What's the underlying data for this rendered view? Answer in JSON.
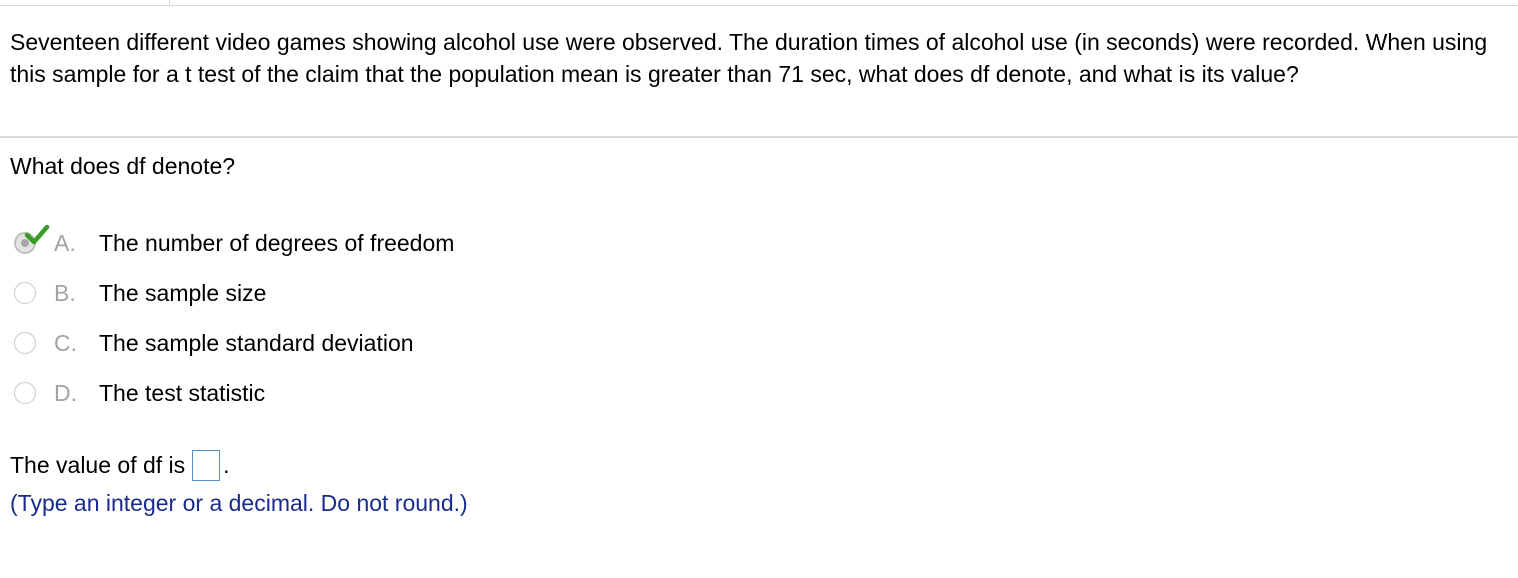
{
  "question": {
    "text": "Seventeen different video games showing alcohol use were observed. The duration times of alcohol use (in seconds) were recorded. When using this sample for a t test of the claim that the population mean is greater than 71 sec, what does df denote, and what is its value?"
  },
  "part1": {
    "prompt": "What does df denote?",
    "selected": "A",
    "choices": [
      {
        "letter": "A.",
        "text": "The number of degrees of freedom",
        "selected": true,
        "correct": true
      },
      {
        "letter": "B.",
        "text": "The sample size",
        "selected": false
      },
      {
        "letter": "C.",
        "text": "The sample standard deviation",
        "selected": false
      },
      {
        "letter": "D.",
        "text": "The test statistic",
        "selected": false
      }
    ]
  },
  "part2": {
    "label": "The value of df is",
    "value": "",
    "suffix": ".",
    "hint": "(Type an integer or a decimal. Do not round.)"
  },
  "icons": {
    "selected_radio": "radio-selected-icon",
    "unselected_radio": "radio-unselected-icon",
    "correct_check": "checkmark-icon"
  },
  "colors": {
    "check_green": "#3a9d23",
    "hint_blue": "#1a2b8c",
    "letter_gray": "#a3a3a3",
    "input_border": "#5b8fc7",
    "divider": "#d9d9d9"
  }
}
